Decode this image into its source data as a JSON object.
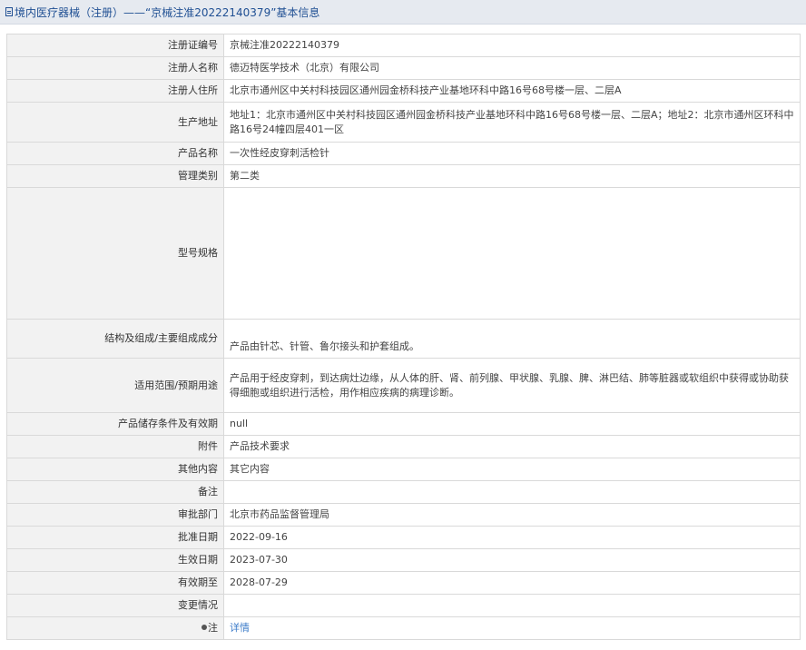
{
  "header": {
    "title": "境内医疗器械（注册）——“京械注准20222140379”基本信息",
    "icon": "document-icon"
  },
  "rows": [
    {
      "label": "注册证编号",
      "value": "京械注准20222140379"
    },
    {
      "label": "注册人名称",
      "value": "德迈特医学技术（北京）有限公司"
    },
    {
      "label": "注册人住所",
      "value": "北京市通州区中关村科技园区通州园金桥科技产业基地环科中路16号68号楼一层、二层A"
    },
    {
      "label": "生产地址",
      "value": "地址1：北京市通州区中关村科技园区通州园金桥科技产业基地环科中路16号68号楼一层、二层A；地址2：北京市通州区环科中路16号24幢四层401一区"
    },
    {
      "label": "产品名称",
      "value": "一次性经皮穿刺活检针"
    },
    {
      "label": "管理类别",
      "value": "第二类"
    },
    {
      "label": "型号规格",
      "value": ""
    },
    {
      "label": "结构及组成/主要组成成分",
      "value": "产品由针芯、针管、鲁尔接头和护套组成。"
    },
    {
      "label": "适用范围/预期用途",
      "value": "产品用于经皮穿刺，到达病灶边缘，从人体的肝、肾、前列腺、甲状腺、乳腺、脾、淋巴结、肺等脏器或软组织中获得或协助获得细胞或组织进行活检，用作相应疾病的病理诊断。"
    },
    {
      "label": "产品储存条件及有效期",
      "value": "null"
    },
    {
      "label": "附件",
      "value": "产品技术要求"
    },
    {
      "label": "其他内容",
      "value": "其它内容"
    },
    {
      "label": "备注",
      "value": ""
    },
    {
      "label": "审批部门",
      "value": "北京市药品监督管理局"
    },
    {
      "label": "批准日期",
      "value": "2022-09-16"
    },
    {
      "label": "生效日期",
      "value": "2023-07-30"
    },
    {
      "label": "有效期至",
      "value": "2028-07-29"
    },
    {
      "label": "变更情况",
      "value": ""
    },
    {
      "label": "注",
      "value": "详情",
      "icon": "pin-icon"
    }
  ]
}
